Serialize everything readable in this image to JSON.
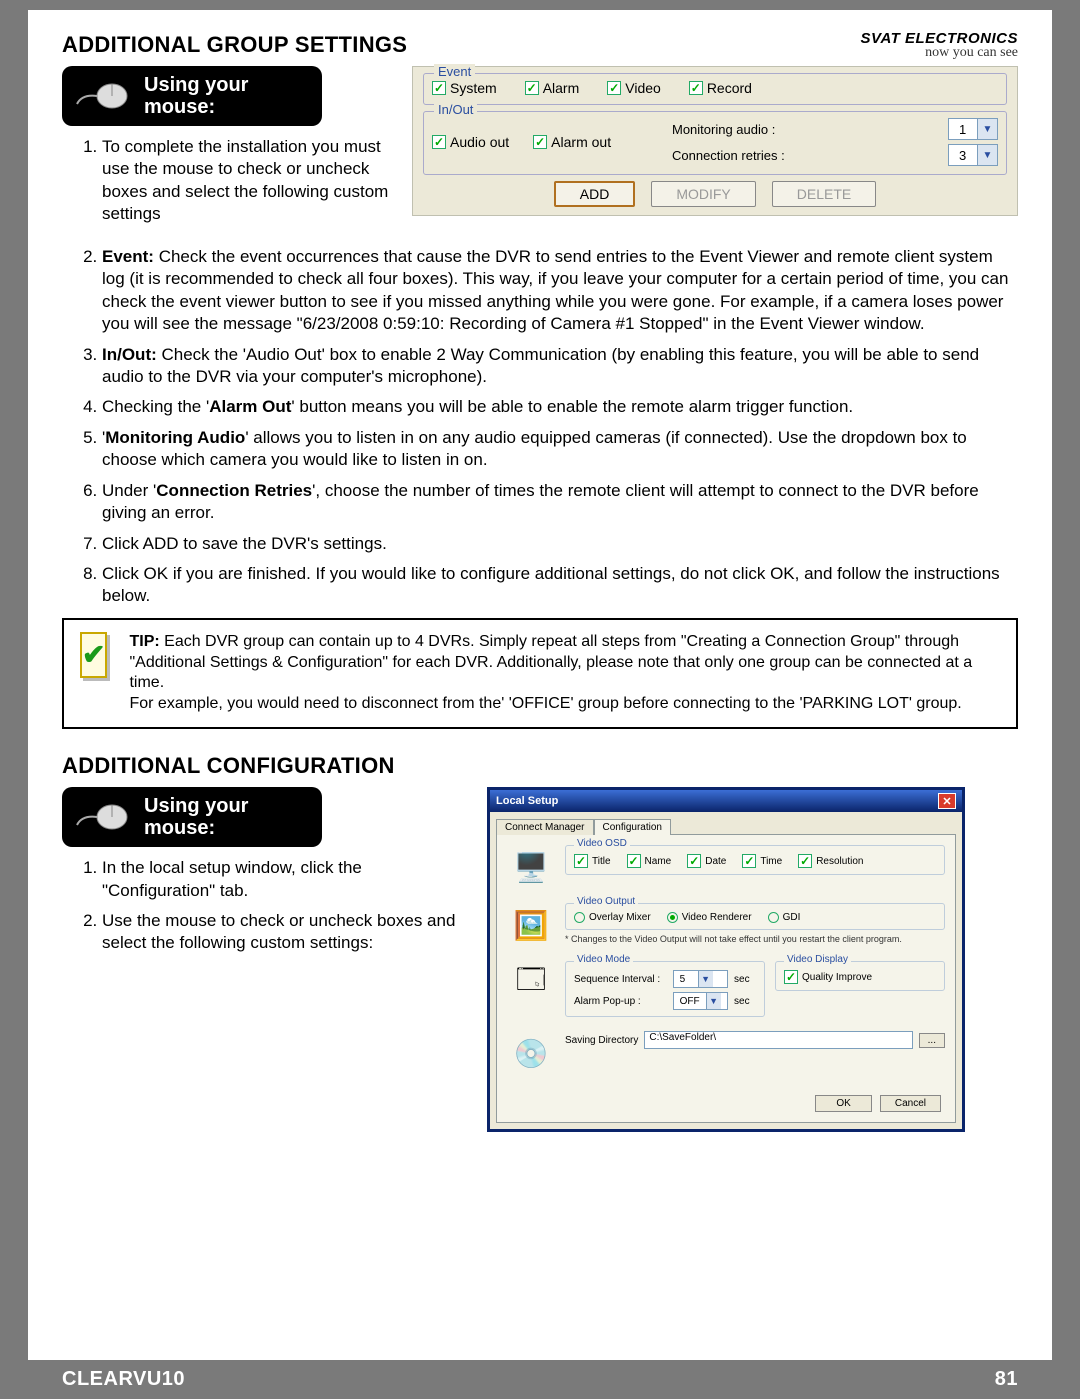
{
  "brand": {
    "name": "SVAT ELECTRONICS",
    "tagline": "now you can see"
  },
  "section1": {
    "title": "ADDITIONAL GROUP SETTINGS",
    "mouse_label": "Using your mouse:",
    "step1": "To complete the installation you must use the mouse to check or uncheck boxes and select the following custom settings",
    "panel": {
      "event_legend": "Event",
      "event_items": {
        "system": "System",
        "alarm": "Alarm",
        "video": "Video",
        "record": "Record"
      },
      "inout_legend": "In/Out",
      "inout_items": {
        "audioout": "Audio out",
        "alarmout": "Alarm out"
      },
      "monitoring_label": "Monitoring audio :",
      "monitoring_val": "1",
      "retries_label": "Connection retries :",
      "retries_val": "3",
      "btn_add": "ADD",
      "btn_modify": "MODIFY",
      "btn_delete": "DELETE"
    },
    "step2_label": "Event:",
    "step2": "Check the event occurrences that cause the DVR to send entries to the Event Viewer and remote client system log (it is recommended to check all four boxes). This way, if you leave your computer for a certain period of time, you can check the event viewer button to see if you missed anything while you were gone. For example, if a camera loses power you will see the message \"6/23/2008 0:59:10: Recording of Camera #1 Stopped\" in the Event Viewer window.",
    "step3_label": "In/Out:",
    "step3": "Check the 'Audio Out' box to enable 2 Way Communication (by enabling this feature, you will be able to send audio to the DVR via your computer's microphone).",
    "step4a": "Checking the '",
    "step4_label": "Alarm Out",
    "step4b": "' button means you will be able to enable the remote alarm trigger function.",
    "step5a": "'",
    "step5_label": "Monitoring Audio",
    "step5b": "' allows you to listen in on any audio equipped cameras (if connected). Use the dropdown box to choose which camera you would like to listen in on.",
    "step6a": "Under '",
    "step6_label": "Connection Retries",
    "step6b": "', choose the number of times the remote client will attempt to connect to the DVR before giving an error.",
    "step7": "Click ADD to save the DVR's settings.",
    "step8": "Click OK if you are finished. If you would like to configure additional settings, do not click OK, and follow the instructions below."
  },
  "tip": {
    "label": "TIP:",
    "line1": "Each DVR group can contain up to 4 DVRs. Simply repeat all steps from \"Creating a Connection Group\" through \"Additional Settings & Configuration\" for each DVR. Additionally, please note that only one group can be connected at a time.",
    "line2": "For example, you would need to disconnect from the' 'OFFICE' group before connecting to the 'PARKING LOT' group."
  },
  "section2": {
    "title": "ADDITIONAL CONFIGURATION",
    "mouse_label": "Using your mouse:",
    "step1": "In the local setup window, click the \"Configuration\" tab.",
    "step2": "Use the mouse to check or uncheck boxes and select the following custom settings:"
  },
  "localsetup": {
    "title": "Local Setup",
    "tab1": "Connect Manager",
    "tab2": "Configuration",
    "osd": {
      "legend": "Video OSD",
      "title": "Title",
      "name": "Name",
      "date": "Date",
      "time": "Time",
      "res": "Resolution"
    },
    "out": {
      "legend": "Video Output",
      "o1": "Overlay Mixer",
      "o2": "Video Renderer",
      "o3": "GDI",
      "note": "* Changes to the Video Output will not take effect until you restart the client program."
    },
    "mode": {
      "legend": "Video Mode",
      "seq_label": "Sequence Interval :",
      "seq_val": "5",
      "sec": "sec",
      "pop_label": "Alarm Pop-up :",
      "pop_val": "OFF"
    },
    "disp": {
      "legend": "Video Display",
      "qi": "Quality Improve"
    },
    "save": {
      "label": "Saving Directory",
      "path": "C:\\SaveFolder\\",
      "browse": "..."
    },
    "ok": "OK",
    "cancel": "Cancel"
  },
  "footer": {
    "product": "CLEARVU10",
    "page": "81"
  }
}
